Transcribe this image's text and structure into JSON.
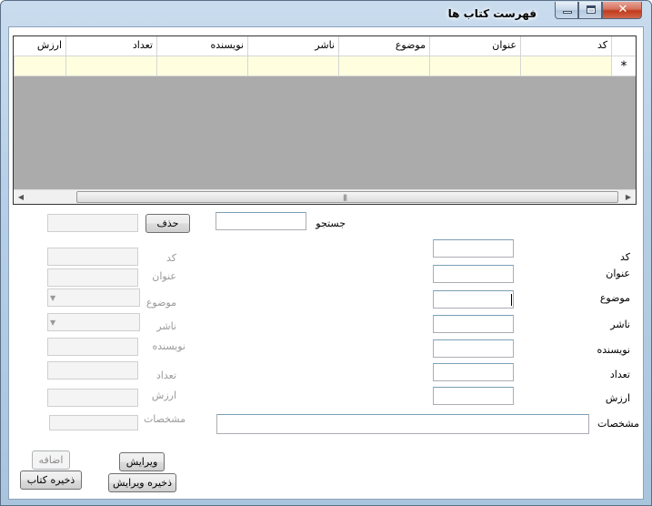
{
  "window": {
    "title": "فهرست کتاب ها"
  },
  "grid": {
    "columns": [
      {
        "key": "code",
        "label": "کد"
      },
      {
        "key": "title",
        "label": "عنوان"
      },
      {
        "key": "subject",
        "label": "موضوع"
      },
      {
        "key": "publisher",
        "label": "ناشر"
      },
      {
        "key": "author",
        "label": "نویسنده"
      },
      {
        "key": "count",
        "label": "تعداد"
      },
      {
        "key": "price",
        "label": "ارزش"
      }
    ],
    "new_row_marker": "*"
  },
  "search": {
    "label": "جستجو",
    "value": ""
  },
  "delete_button": "حذف",
  "delete_field": {
    "value": ""
  },
  "edit_panel": {
    "code_label": "کد",
    "title_label": "عنوان",
    "subject_label": "موضوع",
    "publisher_label": "ناشر",
    "author_label": "نویسنده",
    "count_label": "تعداد",
    "price_label": "ارزش",
    "details_label": "مشخصات"
  },
  "new_form": {
    "code_label": "کد",
    "title_label": "عنوان",
    "subject_label": "موضوع",
    "publisher_label": "ناشر",
    "author_label": "نویسنده",
    "count_label": "تعداد",
    "price_label": "ارزش",
    "details_label": "مشخصات"
  },
  "buttons": {
    "add": "اضافه",
    "save_book": "ذخیره کتاب",
    "edit": "ویرایش",
    "save_edit": "ذخیره ویرایش"
  }
}
